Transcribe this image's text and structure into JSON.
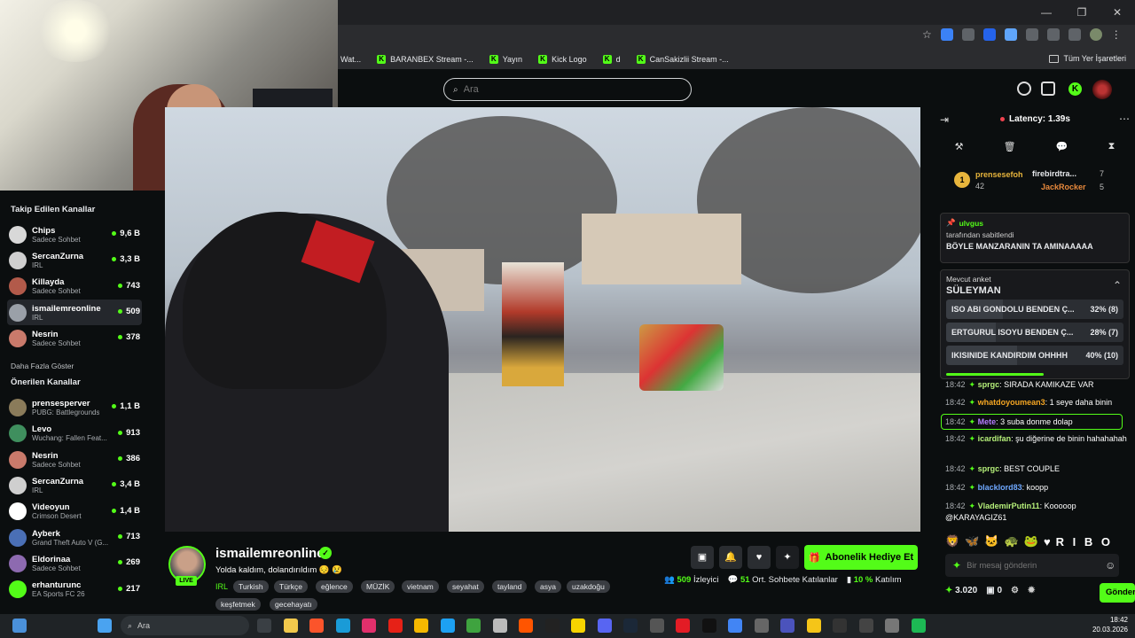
{
  "browser": {
    "min": "—",
    "restore": "❐",
    "close": "✕"
  },
  "bookmarks": [
    {
      "label": "Wat...",
      "kick": false
    },
    {
      "label": "BARANBEX Stream -...",
      "kick": true
    },
    {
      "label": "Yayın",
      "kick": true
    },
    {
      "label": "Kick Logo",
      "kick": true
    },
    {
      "label": "d",
      "kick": true
    },
    {
      "label": "CanSakizlii Stream -...",
      "kick": true
    }
  ],
  "all_bookmarks": "Tüm Yer İşaretleri",
  "search": {
    "placeholder": "Ara"
  },
  "sidebar": {
    "followed_title": "Takip Edilen Kanallar",
    "followed": [
      {
        "name": "Chips",
        "sub": "Sadece Sohbet",
        "count": "9,6 B",
        "color": "#d8d8d8"
      },
      {
        "name": "SercanZurna",
        "sub": "IRL",
        "count": "3,3 B",
        "color": "#cfcfcf"
      },
      {
        "name": "Killayda",
        "sub": "Sadece Sohbet",
        "count": "743",
        "color": "#b25a4a"
      },
      {
        "name": "ismailemreonline",
        "sub": "IRL",
        "count": "509",
        "color": "#9aa0a8"
      },
      {
        "name": "Nesrin",
        "sub": "Sadece Sohbet",
        "count": "378",
        "color": "#c97a6b"
      }
    ],
    "show_more": "Daha Fazla Göster",
    "recommended_title": "Önerilen Kanallar",
    "recommended": [
      {
        "name": "prensesperver",
        "sub": "PUBG: Battlegrounds",
        "count": "1,1 B",
        "color": "#8a7b5a"
      },
      {
        "name": "Levo",
        "sub": "Wuchang: Fallen Feat...",
        "count": "913",
        "color": "#3f8f5e"
      },
      {
        "name": "Nesrin",
        "sub": "Sadece Sohbet",
        "count": "386",
        "color": "#c97a6b"
      },
      {
        "name": "SercanZurna",
        "sub": "IRL",
        "count": "3,4 B",
        "color": "#cfcfcf"
      },
      {
        "name": "Videoyun",
        "sub": "Crimson Desert",
        "count": "1,4 B",
        "color": "#ffffff"
      },
      {
        "name": "Ayberk",
        "sub": "Grand Theft Auto V (G...",
        "count": "713",
        "color": "#4a6fb5"
      },
      {
        "name": "Eldorinaa",
        "sub": "Sadece Sohbet",
        "count": "269",
        "color": "#8d6ab0"
      },
      {
        "name": "erhanturunc",
        "sub": "EA Sports FC 26",
        "count": "217",
        "color": "#53fc18"
      }
    ]
  },
  "stream": {
    "name": "ismailemreonline",
    "title": "Yolda kaldım, dolandırıldım 😔 😢",
    "category": "IRL",
    "live": "LIVE",
    "tags": [
      "Turkish",
      "Türkçe",
      "eğlence",
      "MÜZİK",
      "vietnam",
      "seyahat",
      "tayland",
      "asya",
      "uzakdoğu",
      "keşfetmek",
      "gecehayatı"
    ],
    "subscribe": "Abonelik Hediye Et",
    "viewers": "509",
    "viewers_label": "İzleyici",
    "chatters": "51",
    "chatters_label": "Ort. Sohbete Katılanlar",
    "participation": "10 %",
    "participation_label": "Katılım"
  },
  "chat": {
    "latency": "Latency: 1.39s",
    "gifters": [
      {
        "name": "prensesefoh",
        "count": "42",
        "rank": "1"
      },
      {
        "name": "firebirdtra...",
        "count": "7"
      },
      {
        "name": "JackRocker",
        "count": "5"
      }
    ],
    "pinned_user": "ulvgus",
    "pinned_by": "tarafından sabitlendi",
    "pinned_msg": "BÖYLE MANZARANIN TA AMINAAAAA",
    "poll_label": "Mevcut anket",
    "poll_title": "SÜLEYMAN",
    "poll_options": [
      {
        "text": "ISO ABI GONDOLU BENDEN Ç...",
        "result": "32% (8)",
        "pct": 32
      },
      {
        "text": "ERTGURUL ISOYU BENDEN Ç...",
        "result": "28% (7)",
        "pct": 28
      },
      {
        "text": "IKISINIDE KANDIRDIM OHHHH",
        "result": "40% (10)",
        "pct": 40
      }
    ],
    "messages": [
      {
        "time": "18:42",
        "user": "sprgc",
        "text": "SIRADA KAMIKAZE VAR",
        "color": "#b6f07a"
      },
      {
        "time": "18:42",
        "user": "whatdoyoumean3",
        "text": "1 seye daha binin",
        "color": "#f5a623"
      },
      {
        "time": "18:42",
        "user": "Mete",
        "text": "3 suba donme dolap",
        "color": "#b57cff"
      },
      {
        "time": "18:42",
        "user": "icardifan",
        "text": "şu diğerine de binin hahahahah",
        "color": "#b6f07a"
      },
      {
        "time": "18:42",
        "user": "sprgc",
        "text": "BEST COUPLE",
        "color": "#b6f07a"
      },
      {
        "time": "18:42",
        "user": "blacklord83",
        "text": "koopp",
        "color": "#6fa8ff"
      },
      {
        "time": "18:42",
        "user": "VlademirPutin11",
        "text": "Kooooop",
        "color": "#b6f07a"
      }
    ],
    "mention": "@KARAYAGIZ61",
    "emote_text": "R I B O",
    "input_placeholder": "Bir mesaj gönderin",
    "points": "3.020",
    "count": "0",
    "send": "Gönder"
  },
  "taskbar": {
    "search": "Ara",
    "time": "18:42",
    "date": "20.03.2026"
  }
}
